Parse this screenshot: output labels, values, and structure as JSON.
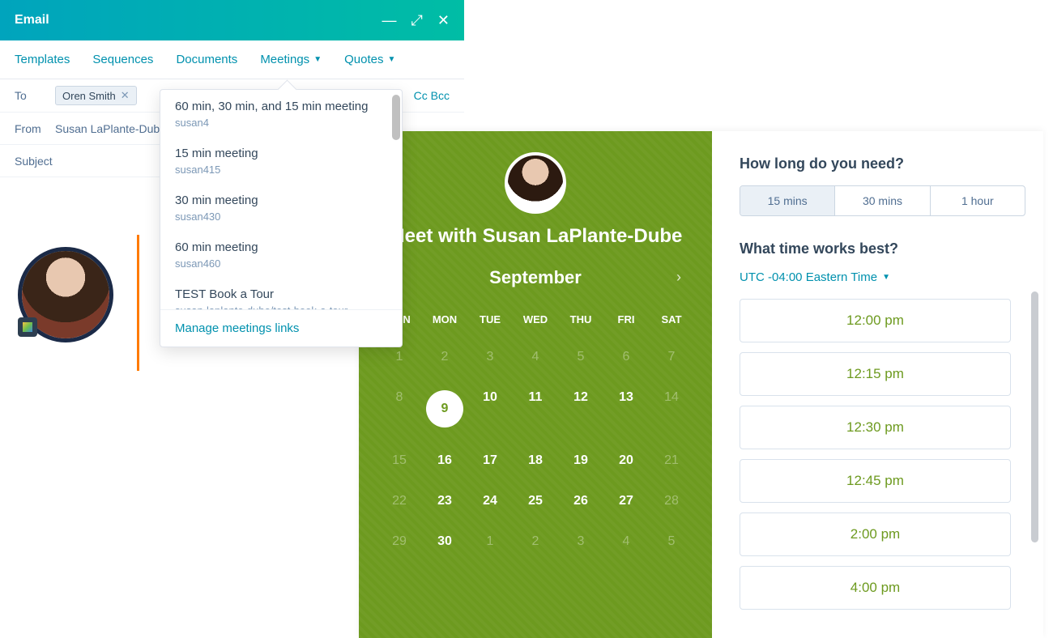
{
  "header": {
    "title": "Email"
  },
  "toolbar": {
    "templates": "Templates",
    "sequences": "Sequences",
    "documents": "Documents",
    "meetings": "Meetings",
    "quotes": "Quotes"
  },
  "compose": {
    "to_label": "To",
    "to_chip": "Oren Smith",
    "from_label": "From",
    "from_value": "Susan LaPlante-Dub",
    "subject_label": "Subject",
    "cc_bcc": "Cc Bcc"
  },
  "meetings_dropdown": {
    "items": [
      {
        "title": "60 min, 30 min, and 15 min meeting",
        "sub": "susan4"
      },
      {
        "title": "15 min meeting",
        "sub": "susan415"
      },
      {
        "title": "30 min meeting",
        "sub": "susan430"
      },
      {
        "title": "60 min meeting",
        "sub": "susan460"
      },
      {
        "title": "TEST Book a Tour",
        "sub": "susan-laplante-dube/test-book-a-tour"
      }
    ],
    "manage": "Manage meetings links"
  },
  "meeting": {
    "title": "Meet with Susan LaPlante-Dube",
    "month": "September",
    "dow": [
      "SUN",
      "MON",
      "TUE",
      "WED",
      "THU",
      "FRI",
      "SAT"
    ],
    "weeks": [
      [
        {
          "n": "1",
          "dim": true
        },
        {
          "n": "2",
          "dim": true
        },
        {
          "n": "3",
          "dim": true
        },
        {
          "n": "4",
          "dim": true
        },
        {
          "n": "5",
          "dim": true
        },
        {
          "n": "6",
          "dim": true
        },
        {
          "n": "7",
          "dim": true
        }
      ],
      [
        {
          "n": "8",
          "dim": true
        },
        {
          "n": "9",
          "sel": true
        },
        {
          "n": "10"
        },
        {
          "n": "11"
        },
        {
          "n": "12"
        },
        {
          "n": "13"
        },
        {
          "n": "14",
          "dim": true
        }
      ],
      [
        {
          "n": "15",
          "dim": true
        },
        {
          "n": "16"
        },
        {
          "n": "17"
        },
        {
          "n": "18"
        },
        {
          "n": "19"
        },
        {
          "n": "20"
        },
        {
          "n": "21",
          "dim": true
        }
      ],
      [
        {
          "n": "22",
          "dim": true
        },
        {
          "n": "23"
        },
        {
          "n": "24"
        },
        {
          "n": "25"
        },
        {
          "n": "26"
        },
        {
          "n": "27"
        },
        {
          "n": "28",
          "dim": true
        }
      ],
      [
        {
          "n": "29",
          "dim": true
        },
        {
          "n": "30"
        },
        {
          "n": "1",
          "dim": true
        },
        {
          "n": "2",
          "dim": true
        },
        {
          "n": "3",
          "dim": true
        },
        {
          "n": "4",
          "dim": true
        },
        {
          "n": "5",
          "dim": true
        }
      ]
    ]
  },
  "slots": {
    "how_long": "How long do you need?",
    "durations": [
      "15 mins",
      "30 mins",
      "1 hour"
    ],
    "active_duration": 0,
    "what_time": "What time works best?",
    "timezone": "UTC -04:00 Eastern Time",
    "times": [
      "12:00 pm",
      "12:15 pm",
      "12:30 pm",
      "12:45 pm",
      "2:00 pm",
      "4:00 pm"
    ]
  }
}
